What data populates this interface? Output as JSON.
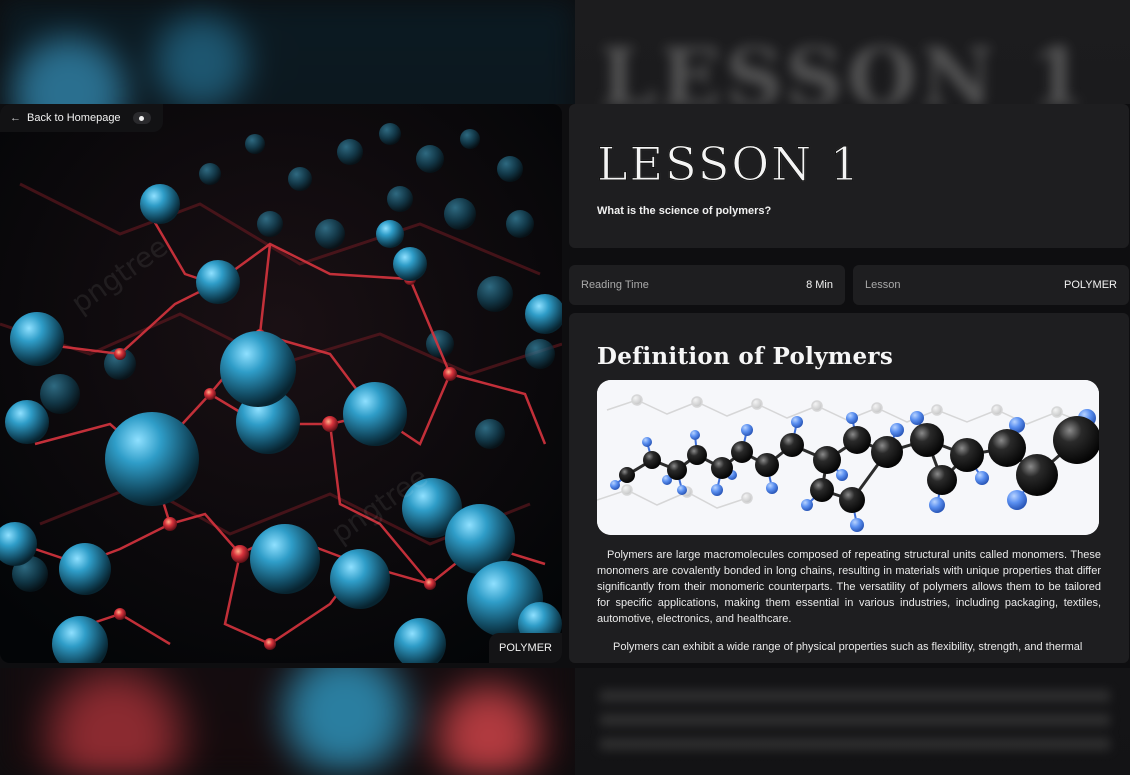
{
  "nav": {
    "back_label": "Back to Homepage",
    "back_arrow": "←"
  },
  "hero": {
    "tag": "POLYMER",
    "watermark": "pngtree"
  },
  "lesson": {
    "title": "LESSON 1",
    "question": "What is the science of polymers?"
  },
  "meta": {
    "reading_time_label": "Reading Time",
    "reading_time_value": "8 Min",
    "lesson_label": "Lesson",
    "lesson_value": "POLYMER"
  },
  "content": {
    "heading": "Definition of Polymers",
    "paragraphs": [
      "Polymers are large macromolecules composed of repeating structural units called monomers. These monomers are covalently bonded in long chains, resulting in materials with unique properties that differ significantly from their monomeric counterparts. The versatility of polymers allows them to be tailored for specific applications, making them essential in various industries, including packaging, textiles, automotive, electronics, and healthcare.",
      "Polymers can exhibit a wide range of physical properties such as flexibility, strength, and thermal"
    ]
  },
  "colors": {
    "panel": "#1e1e20",
    "sphere_blue": "#2f8fb5",
    "bond_red": "#c0303a",
    "atom_black": "#1a1a1a",
    "atom_blue": "#5a8ff0"
  }
}
